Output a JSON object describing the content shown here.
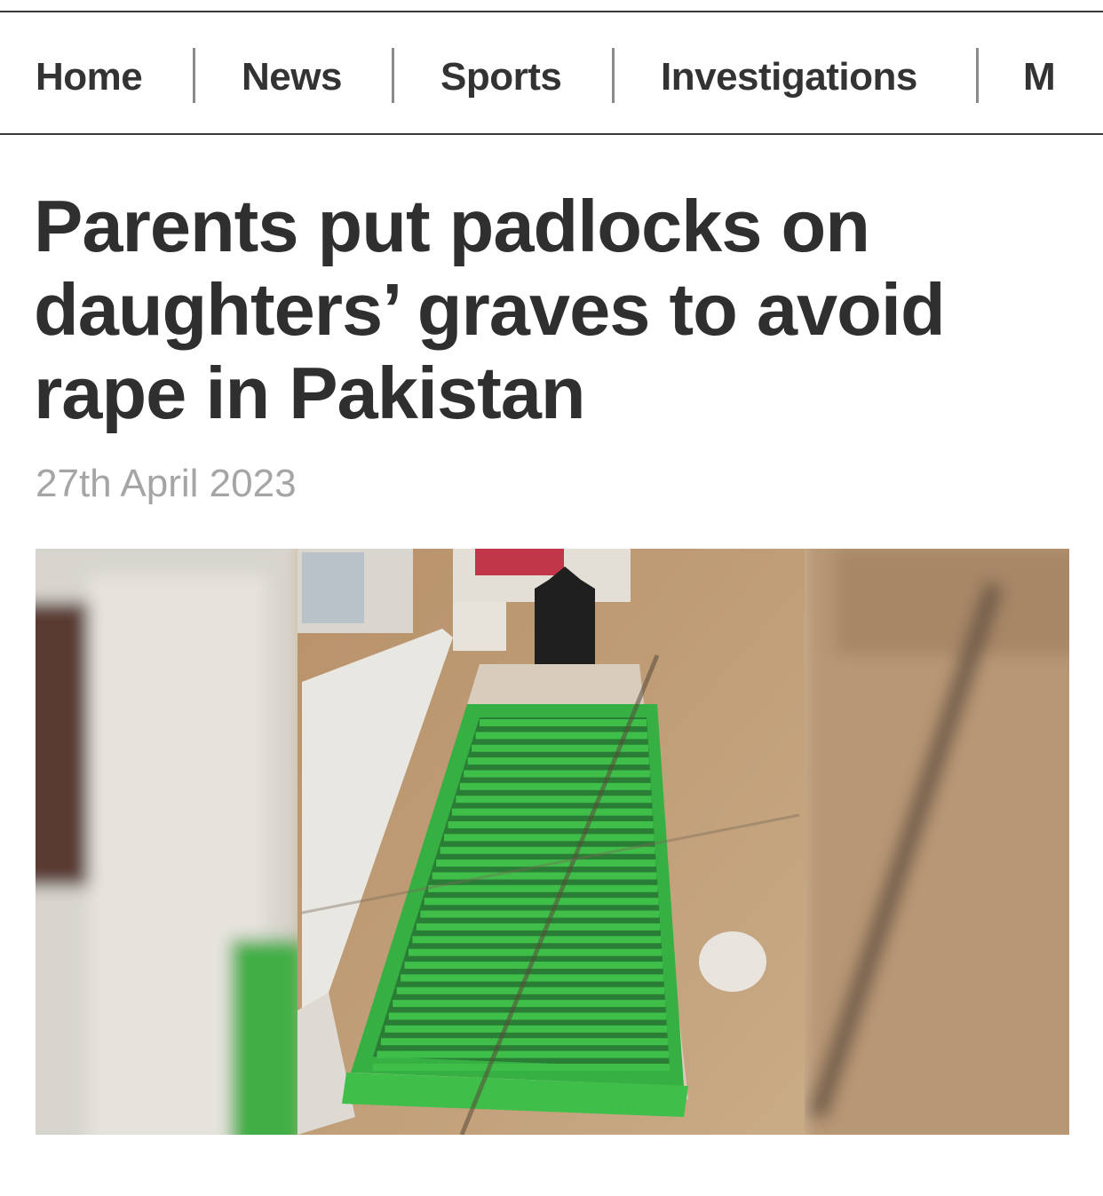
{
  "nav": {
    "items": [
      "Home",
      "News",
      "Sports",
      "Investigations",
      "M"
    ]
  },
  "article": {
    "headline_lines": [
      "Parents put padlocks on",
      "daughters’ graves to avoid",
      "rape in Pakistan"
    ],
    "date": "27th April 2023"
  },
  "photo": {
    "grate_color": "#3fbf4a"
  }
}
